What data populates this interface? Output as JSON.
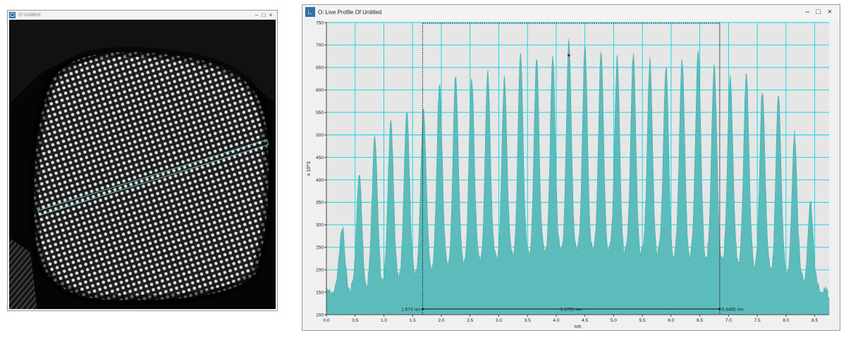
{
  "image_window": {
    "title": "O:Untitled",
    "icon": "image-window-icon",
    "controls": {
      "minimize": "–",
      "maximize": "□",
      "close": "×"
    }
  },
  "profile_window": {
    "title": "O: Live Profile Of Untitled",
    "icon": "profile-window-icon",
    "controls": {
      "minimize": "–",
      "maximize": "□",
      "close": "×"
    }
  },
  "colors": {
    "plot_background": "#e6e6e6",
    "grid": "#00d8e4",
    "fill": "#5cbcbc",
    "stroke": "#3fa6a6",
    "marker": "#8b1a1a"
  },
  "chart_data": {
    "type": "area",
    "title": "",
    "xlabel": "nm",
    "ylabel": "x 10^3",
    "xlim": [
      0,
      8.75
    ],
    "ylim": [
      100,
      750
    ],
    "xticks": [
      "0.0",
      "0.5",
      "1.0",
      "1.5",
      "2.0",
      "2.5",
      "3.0",
      "3.5",
      "4.0",
      "4.5",
      "5.0",
      "5.5",
      "6.0",
      "6.5",
      "7.0",
      "7.5",
      "8.0",
      "8.5"
    ],
    "yticks": [
      "100",
      "150",
      "200",
      "250",
      "300",
      "350",
      "400",
      "450",
      "500",
      "550",
      "600",
      "650",
      "700",
      "750"
    ],
    "grid": true,
    "series": [
      {
        "peaks": [
          {
            "x": 0.27,
            "y": 300
          },
          {
            "x": 0.57,
            "y": 420
          },
          {
            "x": 0.84,
            "y": 505
          },
          {
            "x": 1.12,
            "y": 540
          },
          {
            "x": 1.4,
            "y": 560
          },
          {
            "x": 1.69,
            "y": 565
          },
          {
            "x": 1.97,
            "y": 620
          },
          {
            "x": 2.25,
            "y": 635
          },
          {
            "x": 2.53,
            "y": 630
          },
          {
            "x": 2.81,
            "y": 640
          },
          {
            "x": 3.1,
            "y": 620
          },
          {
            "x": 3.38,
            "y": 680
          },
          {
            "x": 3.66,
            "y": 665
          },
          {
            "x": 3.94,
            "y": 670
          },
          {
            "x": 4.22,
            "y": 705
          },
          {
            "x": 4.5,
            "y": 690
          },
          {
            "x": 4.78,
            "y": 680
          },
          {
            "x": 5.06,
            "y": 670
          },
          {
            "x": 5.34,
            "y": 680
          },
          {
            "x": 5.63,
            "y": 665
          },
          {
            "x": 5.91,
            "y": 655
          },
          {
            "x": 6.19,
            "y": 675
          },
          {
            "x": 6.47,
            "y": 695
          },
          {
            "x": 6.75,
            "y": 660
          },
          {
            "x": 7.03,
            "y": 635
          },
          {
            "x": 7.31,
            "y": 645
          },
          {
            "x": 7.59,
            "y": 605
          },
          {
            "x": 7.87,
            "y": 590
          },
          {
            "x": 8.15,
            "y": 500
          },
          {
            "x": 8.43,
            "y": 350
          }
        ],
        "baseline": [
          {
            "x": 0.0,
            "y": 148
          },
          {
            "x": 0.5,
            "y": 160
          },
          {
            "x": 1.0,
            "y": 180
          },
          {
            "x": 1.5,
            "y": 195
          },
          {
            "x": 2.0,
            "y": 210
          },
          {
            "x": 3.0,
            "y": 225
          },
          {
            "x": 4.0,
            "y": 235
          },
          {
            "x": 5.0,
            "y": 237
          },
          {
            "x": 6.0,
            "y": 232
          },
          {
            "x": 7.0,
            "y": 222
          },
          {
            "x": 8.0,
            "y": 195
          },
          {
            "x": 8.5,
            "y": 165
          },
          {
            "x": 8.75,
            "y": 148
          }
        ]
      }
    ],
    "marker_point": {
      "x": 4.22,
      "y": 677
    },
    "measurement": {
      "start": 1.674,
      "end": 6.8465,
      "width": 5.1725,
      "start_label": "1.674 nm",
      "end_label": "6.8465 nm",
      "width_label": "5.1725 nm"
    }
  }
}
